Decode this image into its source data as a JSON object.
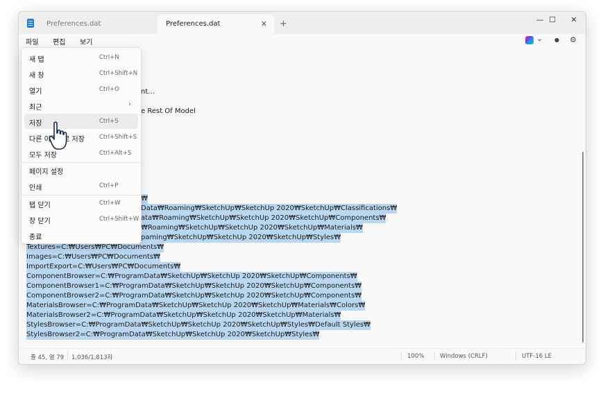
{
  "tabs": [
    {
      "label": "Preferences.dat",
      "active": false
    },
    {
      "label": "Preferences.dat",
      "active": true
    }
  ],
  "tab_close_glyph": "✕",
  "new_tab_glyph": "+",
  "window_controls": {
    "minimize": "—",
    "maximize": "☐",
    "close": "✕"
  },
  "menubar": {
    "file": "파일",
    "edit": "편집",
    "view": "보기"
  },
  "toolbar_icons": [
    "copilot-icon",
    "chevron-down-icon",
    "account-icon",
    "settings-icon"
  ],
  "toolbar_glyphs": {
    "chevron": "⌄",
    "account": "●",
    "settings": "⚙"
  },
  "file_menu": {
    "groups": [
      [
        {
          "label": "새 탭",
          "shortcut": "Ctrl+N"
        },
        {
          "label": "새 창",
          "shortcut": "Ctrl+Shift+N"
        },
        {
          "label": "열기",
          "shortcut": "Ctrl+O"
        },
        {
          "label": "최근",
          "shortcut": "",
          "submenu_glyph": "›"
        },
        {
          "label": "저장",
          "shortcut": "Ctrl+S",
          "hovered": true
        },
        {
          "label": "다른 이름으로 저장",
          "shortcut": "Ctrl+Shift+S"
        },
        {
          "label": "모두 저장",
          "shortcut": "Ctrl+Alt+S"
        }
      ],
      [
        {
          "label": "페이지 설정",
          "shortcut": ""
        },
        {
          "label": "인쇄",
          "shortcut": "Ctrl+P"
        }
      ],
      [
        {
          "label": "탭 닫기",
          "shortcut": "Ctrl+W"
        },
        {
          "label": "창 닫기",
          "shortcut": "Ctrl+Shift+W"
        },
        {
          "label": "종료",
          "shortcut": ""
        }
      ]
    ]
  },
  "editor": {
    "partial_lines": [
      {
        "text": "nt...",
        "y_row": 0
      },
      {
        "text": "e Rest Of Model",
        "y_row": 1
      }
    ],
    "hidden_lines_right": [
      "₩",
      "Data₩Roaming₩SketchUp₩SketchUp 2020₩SketchUp₩Classifications₩",
      "ata₩Roaming₩SketchUp₩SketchUp 2020₩SketchUp₩Components₩",
      "₩Roaming₩SketchUp₩SketchUp 2020₩SketchUp₩Materials₩",
      "paming₩SketchUp₩SketchUp 2020₩SketchUp₩Styles₩"
    ],
    "lines": [
      "Textures=C:₩Users₩PC₩Documents₩",
      "Images=C:₩Users₩PC₩Documents₩",
      "ImportExport=C:₩Users₩PC₩Documents₩",
      "ComponentBrowser=C:₩ProgramData₩SketchUp₩SketchUp 2020₩SketchUp₩Components₩",
      "ComponentBrowser1=C:₩ProgramData₩SketchUp₩SketchUp 2020₩SketchUp₩Components₩",
      "ComponentBrowser2=C:₩ProgramData₩SketchUp₩SketchUp 2020₩SketchUp₩Components₩",
      "MaterialsBrowser=C:₩ProgramData₩SketchUp₩SketchUp 2020₩SketchUp₩Materials₩Colors₩",
      "MaterialsBrowser2=C:₩ProgramData₩SketchUp₩SketchUp 2020₩SketchUp₩Materials₩",
      "StylesBrowser=C:₩ProgramData₩SketchUp₩SketchUp 2020₩SketchUp₩Styles₩Default Styles₩",
      "StylesBrowser2=C:₩ProgramData₩SketchUp₩SketchUp 2020₩SketchUp₩Styles₩"
    ]
  },
  "statusbar": {
    "position": "줄 45, 열 79",
    "count": "1,036/1,813자",
    "zoom": "100%",
    "line_ending": "Windows (CRLF)",
    "encoding": "UTF-16 LE"
  },
  "colors": {
    "selection": "#b9d7f0",
    "accent": "#1a7fd4"
  }
}
